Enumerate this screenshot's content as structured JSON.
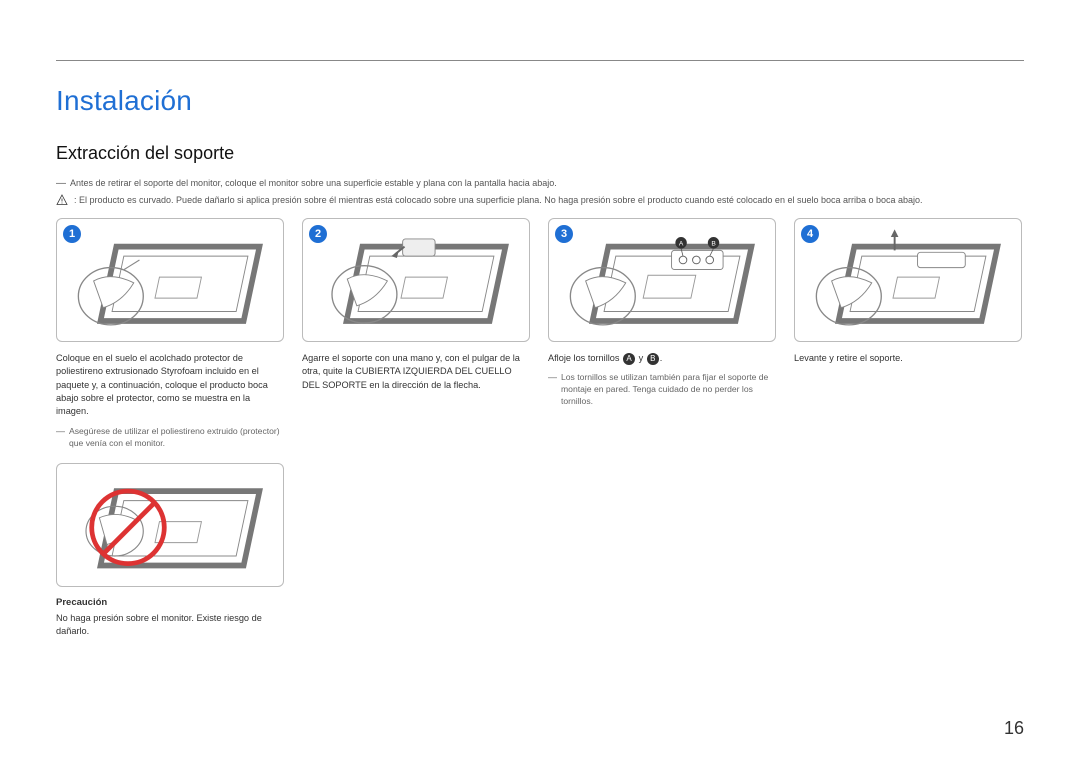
{
  "page_number": "16",
  "title": "Instalación",
  "subtitle": "Extracción del soporte",
  "intro_note": "Antes de retirar el soporte del monitor, coloque el monitor sobre una superficie estable y plana con la pantalla hacia abajo.",
  "warning_text": ": El producto es curvado. Puede dañarlo si aplica presión sobre él mientras está colocado sobre una superficie plana. No haga presión sobre el producto cuando esté colocado en el suelo boca arriba o boca abajo.",
  "steps": [
    {
      "number": "1",
      "desc": "Coloque en el suelo el acolchado protector de poliestireno extrusionado Styrofoam incluido en el paquete y, a continuación, coloque el producto boca abajo sobre el protector, como se muestra en la imagen.",
      "note": "Asegúrese de utilizar el poliestireno extruido (protector) que venía con el monitor.",
      "caution_title": "Precaución",
      "caution_body": "No haga presión sobre el monitor. Existe riesgo de dañarlo."
    },
    {
      "number": "2",
      "desc": "Agarre el soporte con una mano y, con el pulgar de la otra, quite la CUBIERTA IZQUIERDA DEL CUELLO DEL SOPORTE en la dirección de la flecha."
    },
    {
      "number": "3",
      "desc_prefix": "Afloje los tornillos ",
      "desc_mid": " y ",
      "desc_suffix": ".",
      "letter_a": "A",
      "letter_b": "B",
      "note": "Los tornillos se utilizan también para fijar el soporte de montaje en pared. Tenga cuidado de no perder los tornillos."
    },
    {
      "number": "4",
      "desc": "Levante y retire el soporte."
    }
  ]
}
